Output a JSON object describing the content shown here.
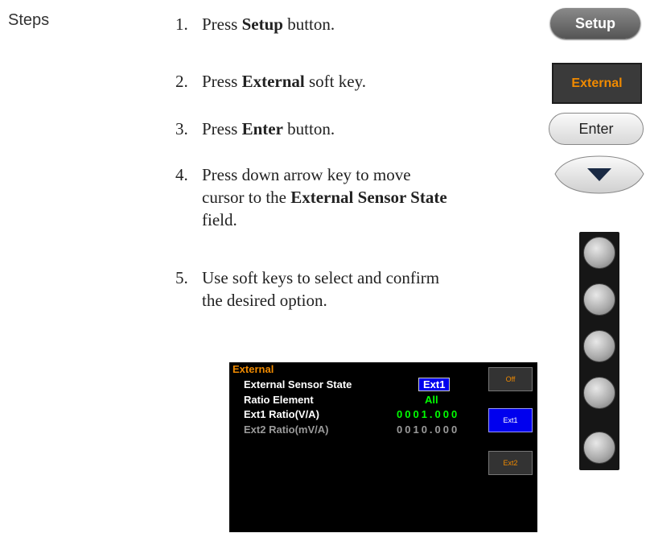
{
  "section_label": "Steps",
  "steps": [
    {
      "num": "1.",
      "pre": "Press ",
      "bold": "Setup",
      "post": " button."
    },
    {
      "num": "2.",
      "pre": "Press ",
      "bold": "External",
      "post": " soft key."
    },
    {
      "num": "3.",
      "pre": "Press ",
      "bold": "Enter",
      "post": " button."
    },
    {
      "num": "4.",
      "line1": "Press down arrow key to move",
      "line2_pre": "cursor to the ",
      "line2_bold": "External Sensor State",
      "line3": "field."
    },
    {
      "num": "5.",
      "line1": "Use soft keys to select and confirm",
      "line2": "the desired option."
    }
  ],
  "buttons": {
    "setup": "Setup",
    "external": "External",
    "enter": "Enter",
    "down_arrow": "down-arrow"
  },
  "screen": {
    "title": "External",
    "rows": [
      {
        "label": "External  Sensor  State",
        "value": "Ext1",
        "value_color": "#ffffff",
        "highlighted": true
      },
      {
        "label": "Ratio  Element",
        "value": "All",
        "value_color": "#00ff00"
      },
      {
        "label": "Ext1  Ratio(V/A)",
        "value": "0001.000",
        "value_color": "#00ff00"
      },
      {
        "label": "Ext2  Ratio(mV/A)",
        "value": "0010.000",
        "value_color": "#9a9a9a",
        "dim": true
      }
    ],
    "softkeys": [
      {
        "label": "Off",
        "active": false
      },
      {
        "label": "Ext1",
        "active": true
      },
      {
        "label": "Ext2",
        "active": false
      }
    ]
  },
  "colors": {
    "accent_orange": "#f08a00",
    "select_blue": "#0000ee",
    "value_green": "#00ff00"
  }
}
